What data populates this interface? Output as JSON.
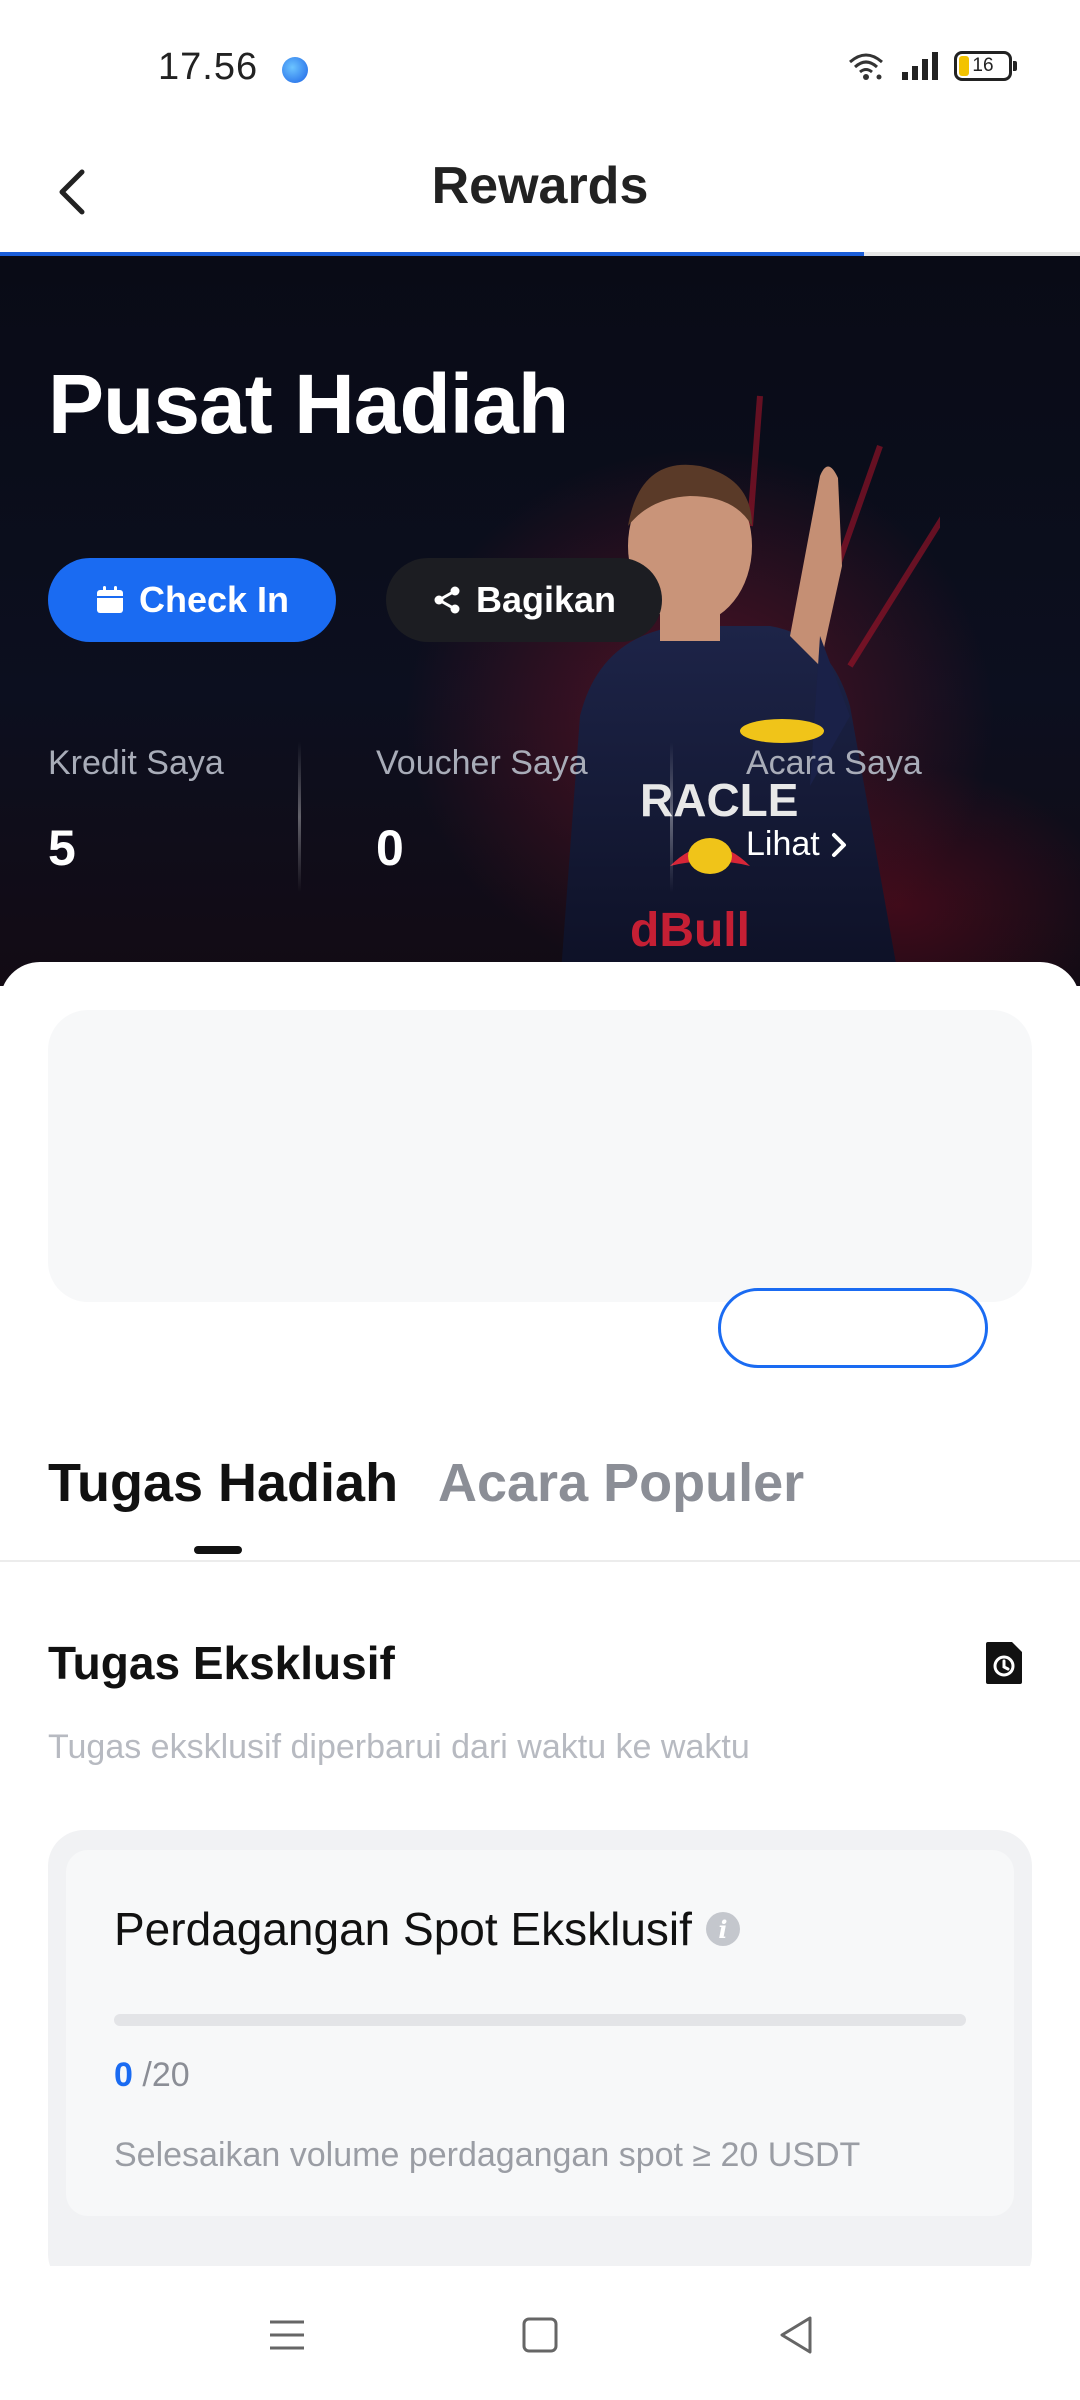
{
  "status_bar": {
    "time": "17.56",
    "battery_level": "16",
    "icons": [
      "app-notification-icon",
      "wifi-icon",
      "signal-icon",
      "battery-icon"
    ]
  },
  "header": {
    "title": "Rewards",
    "back_icon": "chevron-left-icon",
    "page_load_progress": 0.8
  },
  "hero": {
    "title": "Pusat Hadiah",
    "checkin_label": "Check In",
    "share_label": "Bagikan",
    "stats": [
      {
        "label": "Kredit Saya",
        "value": "5"
      },
      {
        "label": "Voucher Saya",
        "value": "0"
      },
      {
        "label": "Acara Saya",
        "link": "Lihat"
      }
    ]
  },
  "tabs": [
    {
      "label": "Tugas Hadiah",
      "active": true
    },
    {
      "label": "Acara Populer",
      "active": false
    }
  ],
  "section": {
    "title": "Tugas Eksklusif",
    "subtitle": "Tugas eksklusif diperbarui dari waktu ke waktu"
  },
  "task": {
    "title": "Perdagangan Spot Eksklusif",
    "current": "0",
    "target": "/20",
    "progress_fraction": 0,
    "description": "Selesaikan volume perdagangan spot ≥ 20 USDT"
  },
  "colors": {
    "accent": "#1a6bf2",
    "hero_bg": "#0c0f1f",
    "share_bg": "#1c1d22"
  },
  "navbar": [
    "menu-icon",
    "home-square-icon",
    "back-triangle-icon"
  ]
}
